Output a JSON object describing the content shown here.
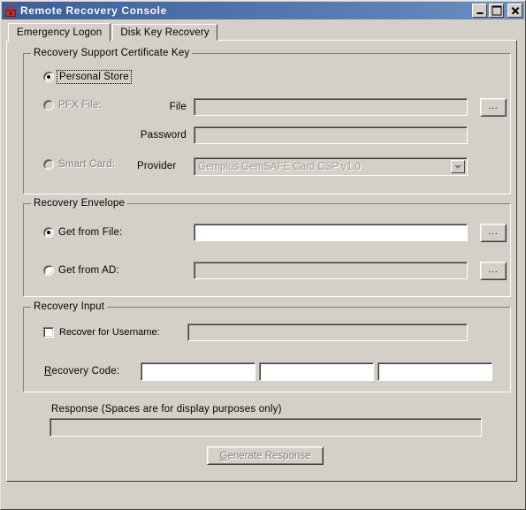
{
  "window": {
    "title": "Remote Recovery Console",
    "icon": "lock-icon",
    "caption_buttons": {
      "minimize": "minimize-button",
      "maximize": "maximize-button",
      "close": "close-button"
    }
  },
  "tabs": [
    {
      "label": "Emergency Logon",
      "active": true
    },
    {
      "label": "Disk Key Recovery",
      "active": false
    }
  ],
  "groups": {
    "cert_key": {
      "title": "Recovery Support Certificate Key",
      "options": [
        {
          "label": "Personal Store",
          "selected": true,
          "enabled": true,
          "focused": true
        },
        {
          "label": "PFX File:",
          "selected": false,
          "enabled": false,
          "focused": false
        },
        {
          "label": "Smart Card:",
          "selected": false,
          "enabled": false,
          "focused": false
        }
      ],
      "file_label": "File",
      "file_value": "",
      "file_placeholder": "",
      "password_label": "Password",
      "password_value": "",
      "provider_label": "Provider",
      "provider_value": "Gemplus GemSAFE Card CSP v1.0",
      "browse_label": "..."
    },
    "envelope": {
      "title": "Recovery Envelope",
      "options": [
        {
          "label": "Get from File:",
          "selected": true,
          "enabled": true
        },
        {
          "label": "Get from AD:",
          "selected": false,
          "enabled": true
        }
      ],
      "file_value": "",
      "ad_value": "",
      "browse_label": "..."
    },
    "input": {
      "title": "Recovery Input",
      "recover_username_label": "Recover for Username:",
      "recover_username_checked": false,
      "username_value": "",
      "recovery_code_label": "Recovery Code:",
      "recovery_code_accel": "R",
      "recovery_code_rest": "ecovery Code:",
      "code_values": [
        "",
        "",
        ""
      ]
    }
  },
  "response": {
    "label": "Response (Spaces are for display purposes only)",
    "value": "",
    "generate_button": {
      "accel": "G",
      "rest": "enerate Response",
      "full_label": "Generate Response",
      "enabled": false
    }
  },
  "colors": {
    "face": "#d4d0c8",
    "titlebar_start": "#3c5f9c",
    "titlebar_end": "#6d8fc4",
    "title_text": "#ffffff",
    "lock_red": "#c42b2b",
    "disabled_text": "#808080",
    "field_white": "#ffffff"
  }
}
